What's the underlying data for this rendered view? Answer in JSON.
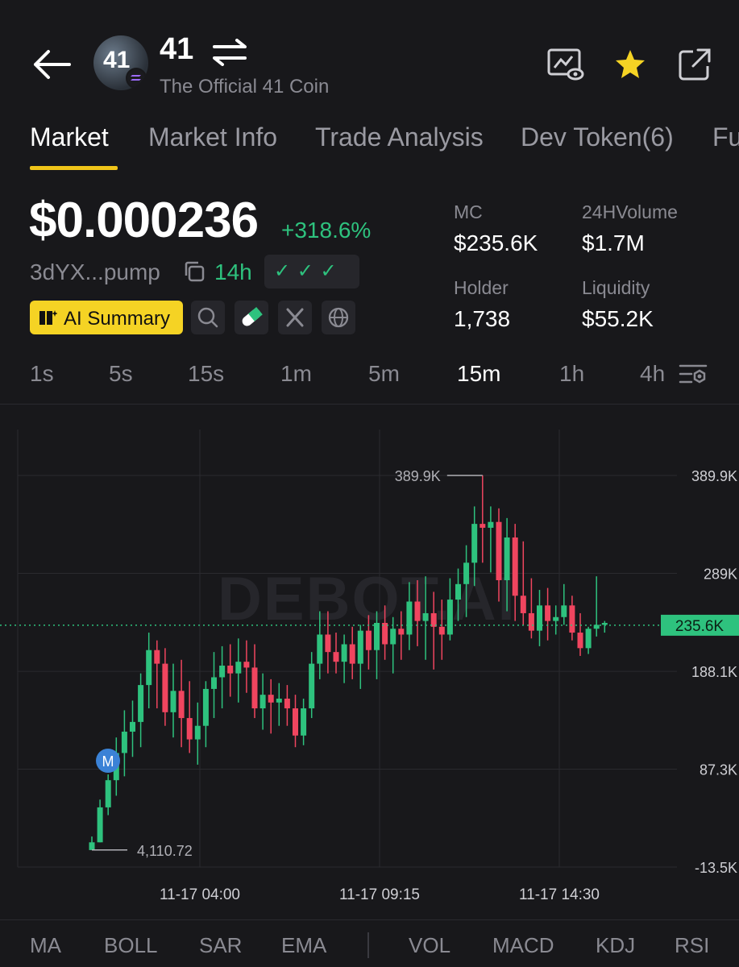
{
  "header": {
    "symbol": "41",
    "name": "The Official 41 Coin",
    "avatar_text": "41",
    "icons": [
      "back-arrow-icon",
      "swap-icon",
      "watchlist-eye-icon",
      "star-icon",
      "share-icon"
    ],
    "star_color": "#f5d324"
  },
  "tabs": [
    {
      "label": "Market",
      "active": true
    },
    {
      "label": "Market Info"
    },
    {
      "label": "Trade Analysis"
    },
    {
      "label": "Dev Token(6)"
    },
    {
      "label": "Fu"
    }
  ],
  "price": {
    "value": "$0.000236",
    "change": "+318.6%",
    "address": "3dYX...pump",
    "age": "14h",
    "checks": "✓ ✓ ✓",
    "ai_summary": "AI Summary"
  },
  "stats": {
    "mc_label": "MC",
    "mc_value": "$235.6K",
    "volume_label": "24HVolume",
    "volume_value": "$1.7M",
    "holder_label": "Holder",
    "holder_value": "1,738",
    "liquidity_label": "Liquidity",
    "liquidity_value": "$55.2K"
  },
  "timeframes": [
    "1s",
    "5s",
    "15s",
    "1m",
    "5m",
    "15m",
    "1h",
    "4h"
  ],
  "active_timeframe": "15m",
  "chart": {
    "watermark": "DEBOT.AI",
    "high_label": "389.9K",
    "low_label": "4,110.72",
    "current_label": "235.6K",
    "marker": "M",
    "y_ticks": [
      "389.9K",
      "289K",
      "188.1K",
      "87.3K",
      "-13.5K"
    ],
    "x_ticks": [
      "11-17 04:00",
      "11-17 09:15",
      "11-17 14:30"
    ]
  },
  "chart_data": {
    "type": "candlestick",
    "y_unit": "market cap (K)",
    "ylim": [
      -13.5,
      389.9
    ],
    "y_ticks": [
      389.9,
      289,
      188.1,
      87.3,
      -13.5
    ],
    "x_ticks": [
      "11-17 04:00",
      "11-17 09:15",
      "11-17 14:30"
    ],
    "current": 235.6,
    "high": 389.9,
    "low": 4.11,
    "colors": {
      "up": "#2ec27e",
      "down": "#f0455f"
    },
    "candles": [
      [
        4,
        18,
        4,
        12
      ],
      [
        12,
        56,
        12,
        48
      ],
      [
        48,
        82,
        40,
        76
      ],
      [
        76,
        120,
        60,
        104
      ],
      [
        104,
        148,
        80,
        126
      ],
      [
        126,
        158,
        100,
        136
      ],
      [
        136,
        186,
        110,
        174
      ],
      [
        174,
        228,
        150,
        210
      ],
      [
        210,
        220,
        150,
        196
      ],
      [
        196,
        212,
        132,
        146
      ],
      [
        146,
        196,
        120,
        168
      ],
      [
        168,
        200,
        110,
        140
      ],
      [
        140,
        178,
        104,
        118
      ],
      [
        118,
        156,
        92,
        132
      ],
      [
        132,
        178,
        110,
        170
      ],
      [
        170,
        208,
        140,
        182
      ],
      [
        182,
        214,
        150,
        194
      ],
      [
        194,
        216,
        162,
        186
      ],
      [
        186,
        222,
        156,
        198
      ],
      [
        198,
        220,
        166,
        192
      ],
      [
        192,
        216,
        140,
        150
      ],
      [
        150,
        186,
        128,
        164
      ],
      [
        164,
        180,
        124,
        156
      ],
      [
        156,
        176,
        132,
        160
      ],
      [
        160,
        174,
        132,
        150
      ],
      [
        150,
        164,
        110,
        122
      ],
      [
        122,
        160,
        112,
        150
      ],
      [
        150,
        208,
        140,
        196
      ],
      [
        196,
        250,
        180,
        226
      ],
      [
        226,
        250,
        186,
        208
      ],
      [
        208,
        228,
        186,
        198
      ],
      [
        198,
        226,
        176,
        216
      ],
      [
        216,
        234,
        180,
        196
      ],
      [
        196,
        236,
        170,
        230
      ],
      [
        230,
        246,
        190,
        210
      ],
      [
        210,
        250,
        180,
        238
      ],
      [
        238,
        256,
        200,
        216
      ],
      [
        216,
        244,
        186,
        232
      ],
      [
        232,
        250,
        200,
        226
      ],
      [
        226,
        280,
        210,
        260
      ],
      [
        260,
        282,
        214,
        240
      ],
      [
        240,
        286,
        200,
        248
      ],
      [
        248,
        270,
        190,
        234
      ],
      [
        234,
        262,
        200,
        226
      ],
      [
        226,
        284,
        220,
        262
      ],
      [
        262,
        294,
        240,
        278
      ],
      [
        278,
        318,
        244,
        300
      ],
      [
        300,
        358,
        276,
        340
      ],
      [
        340,
        390,
        300,
        336
      ],
      [
        336,
        358,
        290,
        342
      ],
      [
        342,
        356,
        260,
        282
      ],
      [
        282,
        346,
        250,
        326
      ],
      [
        326,
        340,
        240,
        266
      ],
      [
        266,
        322,
        236,
        248
      ],
      [
        248,
        284,
        222,
        230
      ],
      [
        230,
        272,
        214,
        256
      ],
      [
        256,
        274,
        220,
        240
      ],
      [
        240,
        256,
        226,
        244
      ],
      [
        244,
        278,
        236,
        256
      ],
      [
        256,
        266,
        220,
        228
      ],
      [
        228,
        248,
        204,
        212
      ],
      [
        212,
        234,
        206,
        232
      ],
      [
        232,
        286,
        224,
        236
      ],
      [
        236,
        240,
        228,
        238
      ]
    ]
  },
  "indicators": [
    "MA",
    "BOLL",
    "SAR",
    "EMA",
    "VOL",
    "MACD",
    "KDJ",
    "RSI"
  ]
}
